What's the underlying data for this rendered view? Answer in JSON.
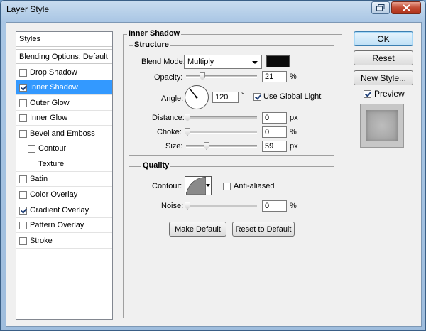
{
  "window": {
    "title": "Layer Style"
  },
  "styles_list": {
    "header": "Styles",
    "blending": "Blending Options: Default",
    "items": [
      {
        "label": "Drop Shadow",
        "checked": false
      },
      {
        "label": "Inner Shadow",
        "checked": true,
        "selected": true
      },
      {
        "label": "Outer Glow",
        "checked": false
      },
      {
        "label": "Inner Glow",
        "checked": false
      },
      {
        "label": "Bevel and Emboss",
        "checked": false
      },
      {
        "label": "Contour",
        "checked": false,
        "sub": true
      },
      {
        "label": "Texture",
        "checked": false,
        "sub": true
      },
      {
        "label": "Satin",
        "checked": false
      },
      {
        "label": "Color Overlay",
        "checked": false
      },
      {
        "label": "Gradient Overlay",
        "checked": true
      },
      {
        "label": "Pattern Overlay",
        "checked": false
      },
      {
        "label": "Stroke",
        "checked": false
      }
    ]
  },
  "panel": {
    "title": "Inner Shadow",
    "structure": {
      "title": "Structure",
      "blend_mode_label": "Blend Mode:",
      "blend_mode_value": "Multiply",
      "shadow_color": "#0a0a0a",
      "opacity_label": "Opacity:",
      "opacity_value": "21",
      "opacity_unit": "%",
      "angle_label": "Angle:",
      "angle_value": "120",
      "angle_unit": "°",
      "global_light_label": "Use Global Light",
      "global_light_checked": true,
      "distance_label": "Distance:",
      "distance_value": "0",
      "distance_unit": "px",
      "choke_label": "Choke:",
      "choke_value": "0",
      "choke_unit": "%",
      "size_label": "Size:",
      "size_value": "59",
      "size_unit": "px"
    },
    "quality": {
      "title": "Quality",
      "contour_label": "Contour:",
      "anti_aliased_label": "Anti-aliased",
      "anti_aliased_checked": false,
      "noise_label": "Noise:",
      "noise_value": "0",
      "noise_unit": "%"
    },
    "make_default": "Make Default",
    "reset_default": "Reset to Default"
  },
  "buttons": {
    "ok": "OK",
    "reset": "Reset",
    "new_style": "New Style...",
    "preview_label": "Preview",
    "preview_checked": true
  }
}
